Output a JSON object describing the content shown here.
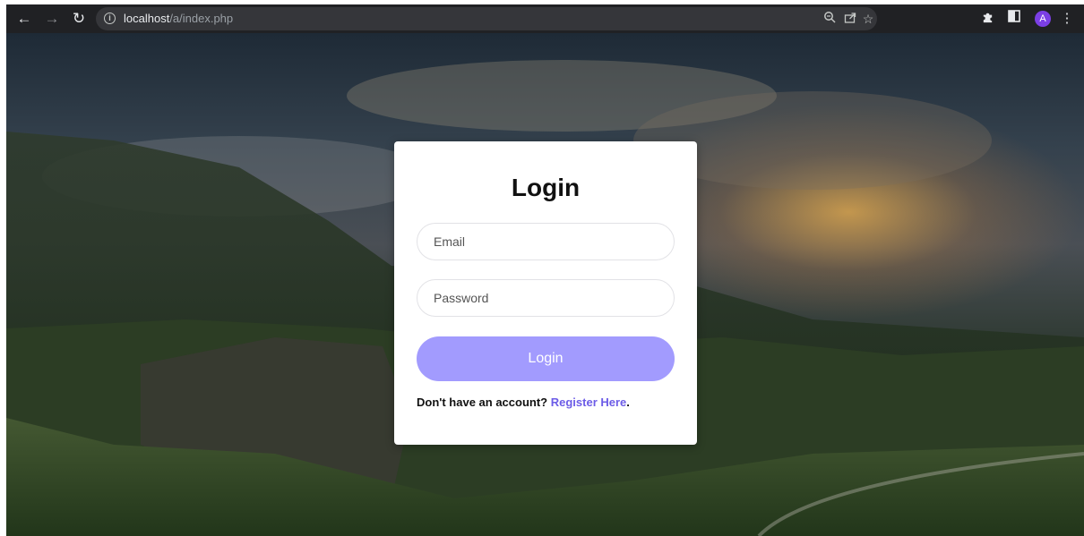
{
  "browser": {
    "url_host": "localhost",
    "url_path": "/a/index.php",
    "profile_initial": "A",
    "icons": [
      "back-arrow-icon",
      "forward-arrow-icon",
      "reload-icon",
      "info-icon",
      "zoom-icon",
      "share-icon",
      "star-icon",
      "extensions-icon",
      "side-panel-icon",
      "more-vert-icon"
    ]
  },
  "login": {
    "title": "Login",
    "email_placeholder": "Email",
    "password_placeholder": "Password",
    "submit_label": "Login",
    "register_prompt": "Don't have an account?",
    "register_link": "Register Here",
    "register_suffix": "."
  },
  "colors": {
    "accent": "#a29bfe",
    "link": "#6c5ce7",
    "chrome_bg": "#202124"
  }
}
